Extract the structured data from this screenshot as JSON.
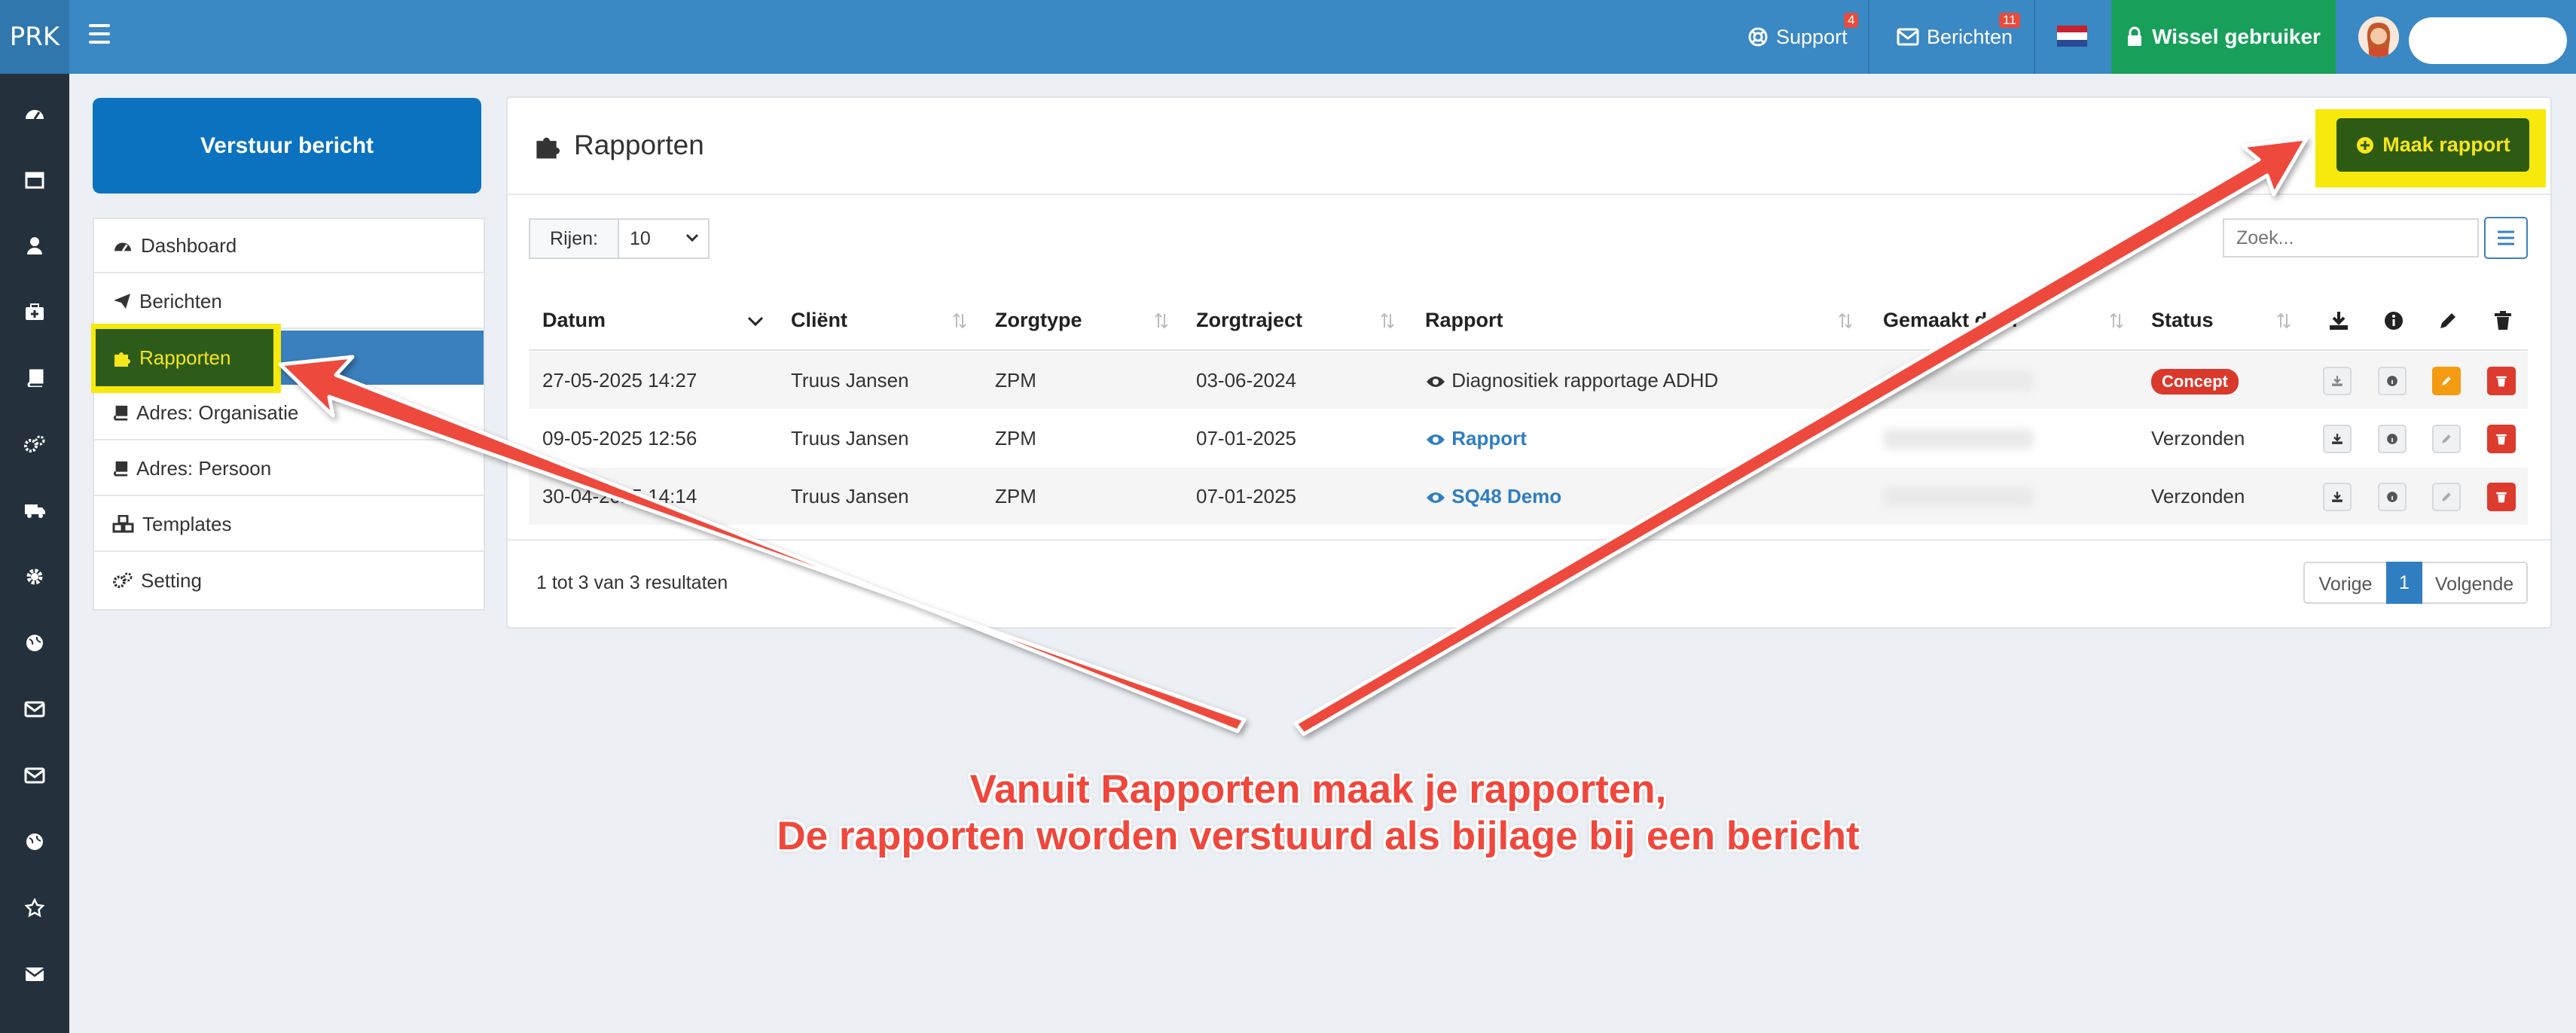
{
  "header": {
    "brand": "PRK",
    "support_label": "Support",
    "support_badge": "4",
    "berichten_label": "Berichten",
    "berichten_badge": "11",
    "wissel_label": "Wissel gebruiker",
    "colors": {
      "bar": "#3a88c4",
      "wissel": "#18a05a"
    }
  },
  "send_button": "Verstuur bericht",
  "menu": [
    {
      "label": "Dashboard",
      "icon": "dashboard-icon"
    },
    {
      "label": "Berichten",
      "icon": "paper-plane-icon"
    },
    {
      "label": "Rapporten",
      "icon": "puzzle-icon",
      "active": true
    },
    {
      "label": "Adres: Organisatie",
      "icon": "book-icon"
    },
    {
      "label": "Adres: Persoon",
      "icon": "book-icon"
    },
    {
      "label": "Templates",
      "icon": "cubes-icon"
    },
    {
      "label": "Setting",
      "icon": "gears-icon"
    }
  ],
  "page": {
    "title": "Rapporten",
    "maak_label": "Maak rapport",
    "rows_label": "Rijen:",
    "rows_value": "10",
    "search_placeholder": "Zoek..."
  },
  "table": {
    "columns": [
      "Datum",
      "Cliënt",
      "Zorgtype",
      "Zorgtraject",
      "Rapport",
      "Gemaakt door",
      "Status"
    ],
    "rows": [
      {
        "datum": "27-05-2025 14:27",
        "client": "Truus Jansen",
        "zorgtype": "ZPM",
        "zorgtraject": "03-06-2024",
        "rapport": "Diagnositiek rapportage ADHD",
        "status": "Concept"
      },
      {
        "datum": "09-05-2025 12:56",
        "client": "Truus Jansen",
        "zorgtype": "ZPM",
        "zorgtraject": "07-01-2025",
        "rapport": "Rapport",
        "status": "Verzonden"
      },
      {
        "datum": "30-04-2025 14:14",
        "client": "Truus Jansen",
        "zorgtype": "ZPM",
        "zorgtraject": "07-01-2025",
        "rapport": "SQ48 Demo",
        "status": "Verzonden"
      }
    ]
  },
  "footer": {
    "results": "1 tot 3 van 3 resultaten",
    "prev": "Vorige",
    "page": "1",
    "next": "Volgende"
  },
  "annotation": {
    "line1": "Vanuit Rapporten maak je rapporten,",
    "line2": "De rapporten worden verstuurd als bijlage bij een bericht",
    "color": "#f0473c"
  }
}
